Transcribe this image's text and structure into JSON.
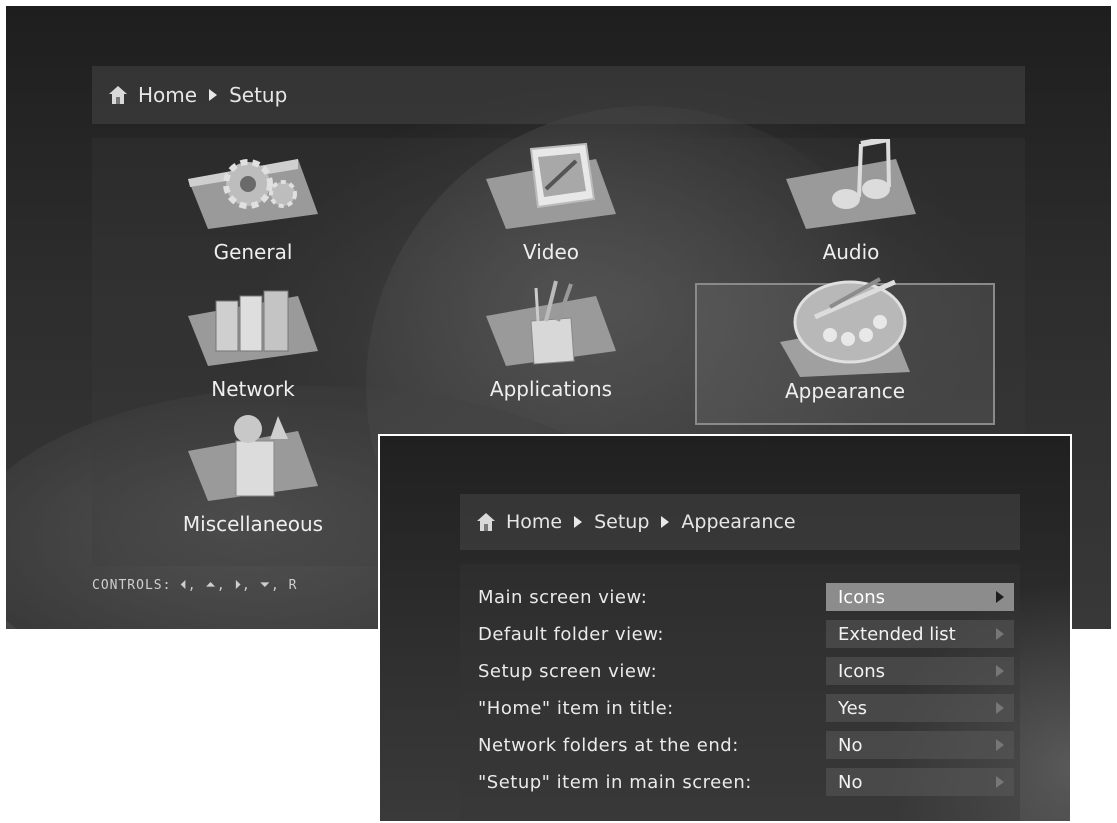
{
  "main_screen": {
    "breadcrumb": [
      "Home",
      "Setup"
    ],
    "tiles": [
      {
        "label": "General",
        "icon": "gear-icon"
      },
      {
        "label": "Video",
        "icon": "video-icon"
      },
      {
        "label": "Audio",
        "icon": "music-icon"
      },
      {
        "label": "Network",
        "icon": "server-icon"
      },
      {
        "label": "Applications",
        "icon": "tools-icon"
      },
      {
        "label": "Appearance",
        "icon": "palette-icon",
        "selected": true
      },
      {
        "label": "Miscellaneous",
        "icon": "misc-icon"
      }
    ],
    "controls_text": "CONTROLS:  ⏴, ⏶, ⏵, ⏷, R"
  },
  "appearance_screen": {
    "breadcrumb": [
      "Home",
      "Setup",
      "Appearance"
    ],
    "settings": [
      {
        "label": "Main screen view:",
        "value": "Icons",
        "selected": true
      },
      {
        "label": "Default folder view:",
        "value": "Extended list"
      },
      {
        "label": "Setup screen view:",
        "value": "Icons"
      },
      {
        "label": "\"Home\" item in title:",
        "value": "Yes"
      },
      {
        "label": "Network folders at the end:",
        "value": "No"
      },
      {
        "label": "\"Setup\" item in main screen:",
        "value": "No"
      }
    ]
  },
  "colors": {
    "selection": "#8c8c8c",
    "background": "#2a2a2a"
  }
}
